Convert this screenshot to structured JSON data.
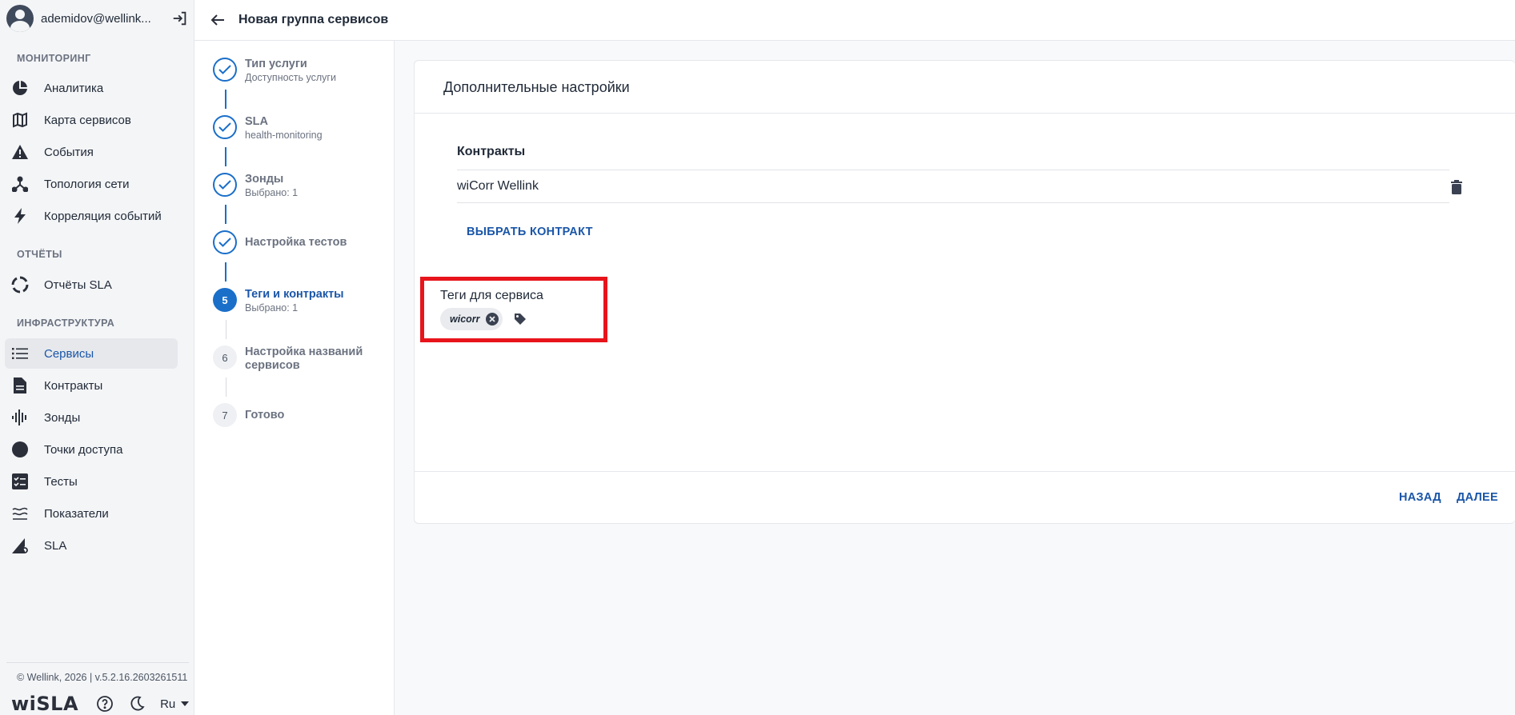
{
  "user": {
    "email": "ademidov@wellink..."
  },
  "sidebar": {
    "sections": [
      {
        "title": "МОНИТОРИНГ"
      },
      {
        "title": "ОТЧЁТЫ"
      },
      {
        "title": "ИНФРАСТРУКТУРА"
      }
    ],
    "items": [
      {
        "label": "Аналитика",
        "icon": "pie-chart-icon"
      },
      {
        "label": "Карта сервисов",
        "icon": "map-icon"
      },
      {
        "label": "События",
        "icon": "warning-icon"
      },
      {
        "label": "Топология сети",
        "icon": "topology-icon"
      },
      {
        "label": "Корреляция событий",
        "icon": "lightning-icon"
      },
      {
        "label": "Отчёты SLA",
        "icon": "report-ring-icon"
      },
      {
        "label": "Сервисы",
        "icon": "list-icon",
        "active": true
      },
      {
        "label": "Контракты",
        "icon": "document-icon"
      },
      {
        "label": "Зонды",
        "icon": "probe-icon"
      },
      {
        "label": "Точки доступа",
        "icon": "circle-icon"
      },
      {
        "label": "Тесты",
        "icon": "checklist-icon"
      },
      {
        "label": "Показатели",
        "icon": "metrics-icon"
      },
      {
        "label": "SLA",
        "icon": "sla-icon"
      }
    ],
    "footer": {
      "version": "© Wellink, 2026 | v.5.2.16.2603261511",
      "logo": "wiSLA",
      "language": "Ru"
    }
  },
  "header": {
    "title": "Новая группа сервисов"
  },
  "stepper": {
    "steps": [
      {
        "title": "Тип услуги",
        "subtitle": "Доступность услуги",
        "state": "done"
      },
      {
        "title": "SLA",
        "subtitle": "health-monitoring",
        "state": "done"
      },
      {
        "title": "Зонды",
        "subtitle": "Выбрано: 1",
        "state": "done"
      },
      {
        "title": "Настройка тестов",
        "subtitle": "",
        "state": "done"
      },
      {
        "number": "5",
        "title": "Теги и контракты",
        "subtitle": "Выбрано: 1",
        "state": "active"
      },
      {
        "number": "6",
        "title": "Настройка названий сервисов",
        "subtitle": "",
        "state": "todo"
      },
      {
        "number": "7",
        "title": "Готово",
        "subtitle": "",
        "state": "todo"
      }
    ]
  },
  "card": {
    "title": "Дополнительные настройки",
    "contracts_label": "Контракты",
    "contracts": [
      {
        "name": "wiCorr Wellink"
      }
    ],
    "select_contract_label": "ВЫБРАТЬ КОНТРАКТ",
    "tags_label": "Теги для сервиса",
    "tags": [
      {
        "name": "wicorr"
      }
    ],
    "back_label": "НАЗАД",
    "next_label": "ДАЛЕЕ"
  },
  "colors": {
    "accent": "#1a6fc9",
    "link": "#1a56a8",
    "highlight": "#e8141b"
  }
}
